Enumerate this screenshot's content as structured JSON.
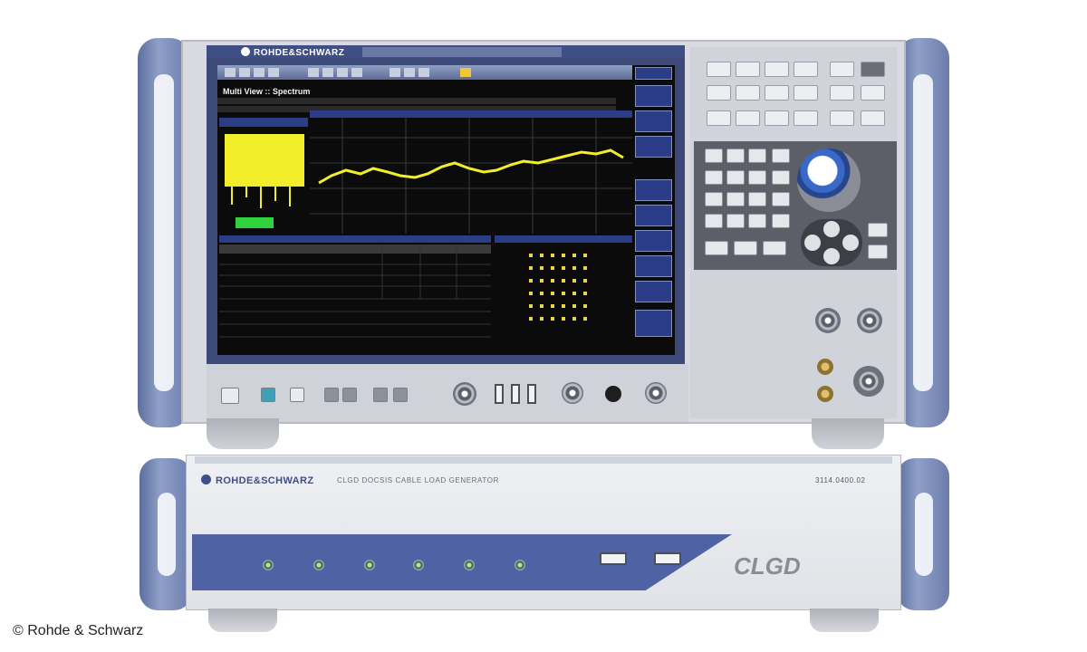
{
  "analyzer": {
    "brand": "ROHDE&SCHWARZ",
    "screen_title": "Multi View  ::  Spectrum"
  },
  "load_generator": {
    "brand": "ROHDE&SCHWARZ",
    "model": "CLGD   DOCSIS CABLE LOAD GENERATOR",
    "serial": "3114.0400.02",
    "logo": "CLGD"
  },
  "copyright": "© Rohde & Schwarz"
}
